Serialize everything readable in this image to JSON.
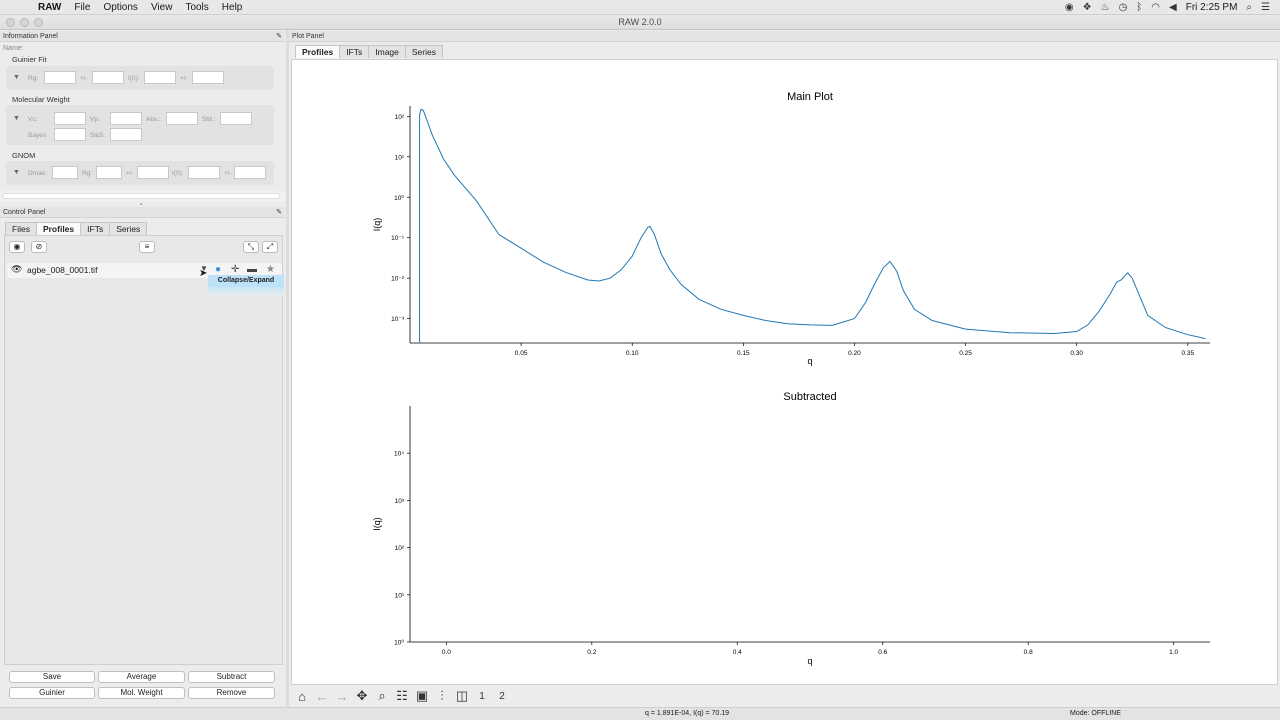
{
  "menubar": {
    "app": "RAW",
    "items": [
      "File",
      "Options",
      "View",
      "Tools",
      "Help"
    ],
    "clock": "Fri 2:25 PM"
  },
  "window": {
    "title": "RAW 2.0.0"
  },
  "info_panel": {
    "title": "Information Panel",
    "name_label": "Name:",
    "guinier": {
      "title": "Guinier Fit",
      "rg": "Rg:",
      "pm1": "+/-",
      "i0": "I(0):",
      "pm2": "+/-"
    },
    "mw": {
      "title": "Molecular Weight",
      "vc": "Vc:",
      "vp": "Vp:",
      "abs": "Abs.:",
      "std": "Std.:",
      "bayes": "Bayes",
      "ss": "S&S:"
    },
    "gnom": {
      "title": "GNOM",
      "dmax": "Dmax:",
      "rg": "Rg:",
      "pm1": "+/-",
      "i0": "I(0):",
      "pm2": "+/-"
    }
  },
  "control_panel": {
    "title": "Control Panel",
    "tabs": [
      "Files",
      "Profiles",
      "IFTs",
      "Series"
    ],
    "file_name": "agbe_008_0001.tif",
    "tooltip": "Collapse/Expand",
    "buttons": [
      "Save",
      "Average",
      "Subtract",
      "Guinier",
      "Mol. Weight",
      "Remove"
    ]
  },
  "plot_panel": {
    "title": "Plot Panel",
    "tabs": [
      "Profiles",
      "IFTs",
      "Image",
      "Series"
    ]
  },
  "status": {
    "coords": "q = 1.891E-04, I(q) = 70.19",
    "mode": "Mode: OFFLINE"
  },
  "chart_data": [
    {
      "type": "line",
      "title": "Main Plot",
      "xlabel": "q",
      "ylabel": "I(q)",
      "xscale": "linear",
      "yscale": "log",
      "xlim": [
        0.0,
        0.36
      ],
      "ylim": [
        0.00025,
        180
      ],
      "xticks": [
        "0.05",
        "0.10",
        "0.15",
        "0.20",
        "0.25",
        "0.30",
        "0.35"
      ],
      "yticks": [
        "10²",
        "10¹",
        "10⁰",
        "10⁻¹",
        "10⁻²",
        "10⁻³"
      ],
      "series": [
        {
          "color": "#1f77b4",
          "x": [
            0.0043,
            0.005,
            0.006,
            0.008,
            0.01,
            0.015,
            0.02,
            0.03,
            0.04,
            0.05,
            0.06,
            0.07,
            0.08,
            0.085,
            0.09,
            0.095,
            0.1,
            0.104,
            0.107,
            0.108,
            0.11,
            0.113,
            0.117,
            0.122,
            0.13,
            0.14,
            0.15,
            0.16,
            0.17,
            0.18,
            0.19,
            0.2,
            0.205,
            0.209,
            0.213,
            0.216,
            0.219,
            0.222,
            0.227,
            0.235,
            0.25,
            0.27,
            0.29,
            0.3,
            0.305,
            0.31,
            0.315,
            0.318,
            0.32,
            0.322,
            0.323,
            0.325,
            0.328,
            0.332,
            0.34,
            0.35,
            0.355,
            0.358
          ],
          "y": [
            110,
            150,
            140,
            70,
            35,
            9,
            3.5,
            0.8,
            0.12,
            0.055,
            0.025,
            0.014,
            0.009,
            0.0085,
            0.01,
            0.016,
            0.035,
            0.1,
            0.18,
            0.19,
            0.12,
            0.04,
            0.016,
            0.007,
            0.003,
            0.0017,
            0.0012,
            0.0009,
            0.00075,
            0.0007,
            0.00068,
            0.001,
            0.0025,
            0.007,
            0.018,
            0.026,
            0.015,
            0.005,
            0.0017,
            0.0009,
            0.00055,
            0.00045,
            0.00043,
            0.00048,
            0.0007,
            0.0015,
            0.004,
            0.008,
            0.009,
            0.012,
            0.0135,
            0.01,
            0.004,
            0.0012,
            0.0006,
            0.0004,
            0.00035,
            0.00032
          ]
        }
      ]
    },
    {
      "type": "line",
      "title": "Subtracted",
      "xlabel": "q",
      "ylabel": "I(q)",
      "xscale": "linear",
      "yscale": "log",
      "xlim": [
        -0.05,
        1.05
      ],
      "ylim": [
        1,
        100000
      ],
      "xticks": [
        "0.0",
        "0.2",
        "0.4",
        "0.6",
        "0.8",
        "1.0"
      ],
      "yticks": [
        "10⁴",
        "10³",
        "10²",
        "10¹",
        "10⁰"
      ],
      "series": []
    }
  ]
}
